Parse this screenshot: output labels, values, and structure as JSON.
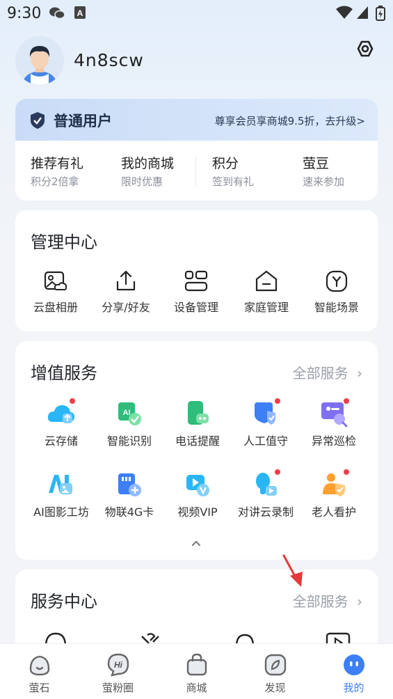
{
  "status_bar": {
    "time": "9:30"
  },
  "profile": {
    "username": "4n8scw"
  },
  "member": {
    "title": "普通用户",
    "promo": "尊享会员享商城9.5折，去升级>",
    "items": [
      {
        "title": "推荐有礼",
        "sub": "积分2倍拿"
      },
      {
        "title": "我的商城",
        "sub": "限时优惠"
      },
      {
        "title": "积分",
        "sub": "签到有礼"
      },
      {
        "title": "萤豆",
        "sub": "速来参加"
      }
    ]
  },
  "management": {
    "title": "管理中心",
    "items": [
      {
        "label": "云盘相册",
        "icon": "album-icon"
      },
      {
        "label": "分享/好友",
        "icon": "share-icon"
      },
      {
        "label": "设备管理",
        "icon": "device-icon"
      },
      {
        "label": "家庭管理",
        "icon": "home-icon"
      },
      {
        "label": "智能场景",
        "icon": "scene-icon"
      }
    ]
  },
  "value_services": {
    "title": "增值服务",
    "more": "全部服务",
    "items": [
      {
        "label": "云存储",
        "icon": "cloud-storage-icon",
        "dot": true
      },
      {
        "label": "智能识别",
        "icon": "ai-recognition-icon",
        "dot": false
      },
      {
        "label": "电话提醒",
        "icon": "phone-alert-icon",
        "dot": false
      },
      {
        "label": "人工值守",
        "icon": "guard-icon",
        "dot": true
      },
      {
        "label": "异常巡检",
        "icon": "inspection-icon",
        "dot": true
      },
      {
        "label": "AI图影工坊",
        "icon": "ai-studio-icon",
        "dot": false
      },
      {
        "label": "物联4G卡",
        "icon": "sim-card-icon",
        "dot": false
      },
      {
        "label": "视频VIP",
        "icon": "video-vip-icon",
        "dot": false
      },
      {
        "label": "对讲云录制",
        "icon": "intercom-record-icon",
        "dot": true
      },
      {
        "label": "老人看护",
        "icon": "elder-care-icon",
        "dot": true
      }
    ]
  },
  "service_center": {
    "title": "服务中心",
    "more": "全部服务"
  },
  "tabs": [
    {
      "label": "萤石",
      "icon": "ezviz-icon"
    },
    {
      "label": "萤粉圈",
      "icon": "hi-icon"
    },
    {
      "label": "商城",
      "icon": "shop-bag-icon"
    },
    {
      "label": "发现",
      "icon": "discover-icon"
    },
    {
      "label": "我的",
      "icon": "me-icon",
      "active": true
    }
  ],
  "colors": {
    "accent": "#3d7ff5",
    "red_dot": "#f23d4a",
    "active_tab": "#3d7ff5"
  }
}
